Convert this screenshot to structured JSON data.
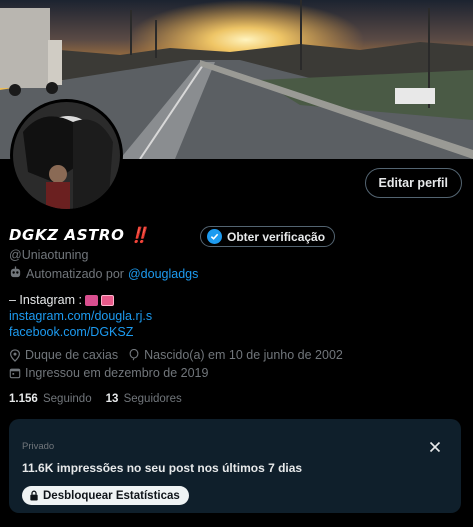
{
  "profile": {
    "display_name": "𝘿𝙂𝙆𝙕 𝘼𝙎𝙏𝙍𝙊 ‼️",
    "handle": "@Uniaotuning",
    "automated_label": "Automatizado por",
    "automated_by": "@dougladgs",
    "edit_button": "Editar perfil",
    "verify_button": "Obter verificação"
  },
  "bio": {
    "line1": "– Instagram :",
    "link1": "instagram.com/dougla.rj.s",
    "link2": "facebook.com/DGKSZ"
  },
  "meta": {
    "location": "Duque de caxias",
    "birthday": "Nascido(a) em 10 de junho de 2002",
    "joined": "Ingressou em dezembro de 2019"
  },
  "follow": {
    "following_count": "1.156",
    "following_label": "Seguindo",
    "followers_count": "13",
    "followers_label": "Seguidores"
  },
  "stats_card": {
    "private_label": "Privado",
    "text": "11.6K impressões no seu post nos últimos 7 dias",
    "button": "Desbloquear Estatísticas"
  },
  "colors": {
    "accent": "#1d9bf0",
    "muted": "#71767b",
    "card_bg": "#0f1f2b"
  }
}
